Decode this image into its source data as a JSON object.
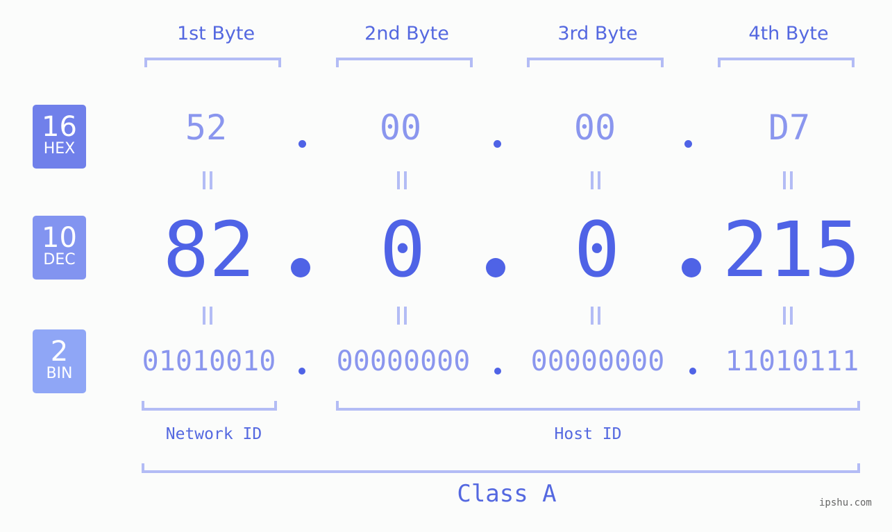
{
  "bytes": [
    {
      "title": "1st Byte",
      "hex": "52",
      "dec": "82",
      "bin": "01010010"
    },
    {
      "title": "2nd Byte",
      "hex": "00",
      "dec": "0",
      "bin": "00000000"
    },
    {
      "title": "3rd Byte",
      "hex": "00",
      "dec": "0",
      "bin": "00000000"
    },
    {
      "title": "4th Byte",
      "hex": "D7",
      "dec": "215",
      "bin": "11010111"
    }
  ],
  "badges": {
    "hex": {
      "num": "16",
      "label": "HEX",
      "color": "#7080ea"
    },
    "dec": {
      "num": "10",
      "label": "DEC",
      "color": "#8294f0"
    },
    "bin": {
      "num": "2",
      "label": "BIN",
      "color": "#8fa6f6"
    }
  },
  "labels": {
    "network": "Network ID",
    "host": "Host ID",
    "class": "Class A"
  },
  "brand": "ipshu.com",
  "colors": {
    "accent": "#4f63e6",
    "light": "#8a96ee",
    "bracket": "#b3bcf5"
  }
}
